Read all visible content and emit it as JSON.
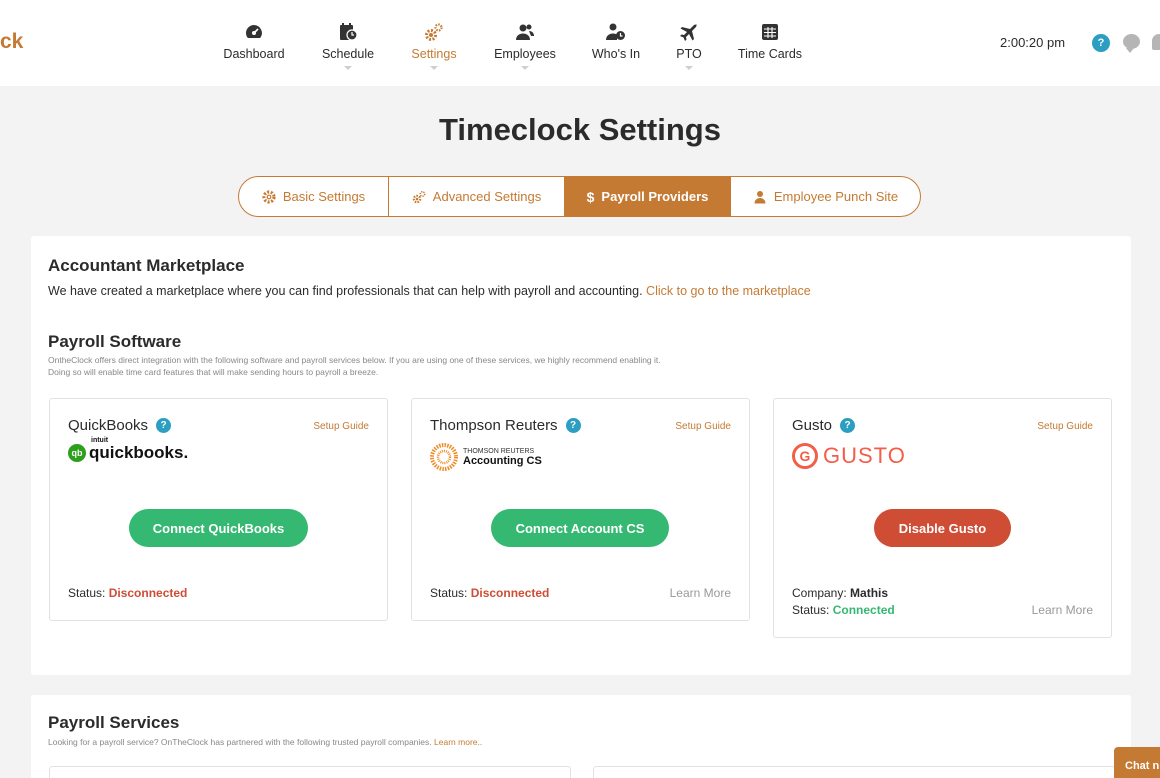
{
  "brand": {
    "logo_text": "ck",
    "accent": "#c57a33"
  },
  "nav": {
    "items": [
      {
        "label": "Dashboard",
        "icon": "dashboard-gauge-icon"
      },
      {
        "label": "Schedule",
        "icon": "calendar-clock-icon"
      },
      {
        "label": "Settings",
        "icon": "gears-icon",
        "active": true
      },
      {
        "label": "Employees",
        "icon": "users-icon"
      },
      {
        "label": "Who's In",
        "icon": "user-clock-icon"
      },
      {
        "label": "PTO",
        "icon": "plane-icon"
      },
      {
        "label": "Time Cards",
        "icon": "table-icon"
      }
    ],
    "clock": "2:00:20 pm",
    "help": "?"
  },
  "page_title": "Timeclock Settings",
  "tabs": [
    {
      "label": "Basic Settings",
      "icon": "gear-icon"
    },
    {
      "label": "Advanced Settings",
      "icon": "gears-icon"
    },
    {
      "label": "Payroll Providers",
      "icon": "dollar-icon",
      "active": true
    },
    {
      "label": "Employee Punch Site",
      "icon": "user-icon"
    }
  ],
  "marketplace": {
    "title": "Accountant Marketplace",
    "text": "We have created a marketplace where you can find professionals that can help with payroll and accounting.",
    "link": "Click to go to the marketplace"
  },
  "payroll_software": {
    "title": "Payroll Software",
    "desc_line1": "OntheClock offers direct integration with the following software and payroll services below. If you are using one of these services, we highly recommend enabling it.",
    "desc_line2": "Doing so will enable time card features that will make sending hours to payroll a breeze.",
    "cards": [
      {
        "title": "QuickBooks",
        "setup_guide": "Setup Guide",
        "logo_small": "intuit",
        "logo_main": "quickbooks.",
        "button": "Connect QuickBooks",
        "status_label": "Status:",
        "status_value": "Disconnected"
      },
      {
        "title": "Thompson Reuters",
        "setup_guide": "Setup Guide",
        "logo_small": "THOMSON REUTERS",
        "logo_main": "Accounting CS",
        "button": "Connect Account CS",
        "status_label": "Status:",
        "status_value": "Disconnected",
        "learn_more": "Learn More"
      },
      {
        "title": "Gusto",
        "setup_guide": "Setup Guide",
        "logo_main": "GUSTO",
        "button": "Disable Gusto",
        "company_label": "Company:",
        "company_value": "Mathis",
        "status_label": "Status:",
        "status_value": "Connected",
        "learn_more": "Learn More"
      }
    ]
  },
  "payroll_services": {
    "title": "Payroll Services",
    "desc": "Looking for a payroll service? OnTheClock has partnered with the following trusted payroll companies.",
    "link": "Learn more.."
  },
  "chat": {
    "label": "Chat n"
  },
  "colors": {
    "green": "#35b872",
    "red": "#cf4c35",
    "blue": "#2b9ec2"
  }
}
